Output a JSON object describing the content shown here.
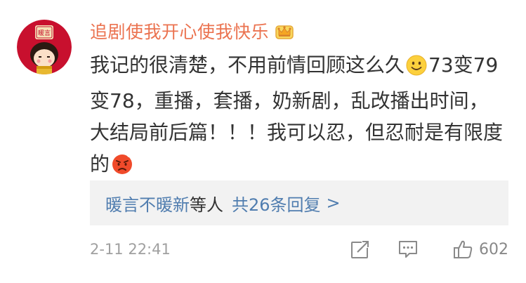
{
  "comment": {
    "username": "追剧使我开心使我快乐",
    "avatar_text": "暖言",
    "body": {
      "part1": "我记的很清楚，不用前情回顾这么久",
      "part2": "73变79变78，重播，套播，奶新剧，乱改播出时间，大结局前后篇！！！我可以忍，但忍耐是有限度的"
    },
    "emoji_1": "smile-emoji",
    "emoji_2": "angry-emoji",
    "badge_icon": "crown-icon",
    "replies": {
      "link_name": "暖言不暖新",
      "suffix": "等人",
      "count_text": "共26条回复",
      "chevron": ">"
    },
    "timestamp": "2-11 22:41",
    "likes": "602",
    "action_icons": [
      "share-icon",
      "comment-icon",
      "like-icon"
    ]
  },
  "colors": {
    "username": "#eb7350",
    "link": "#507daf",
    "text": "#333333",
    "meta": "#a0a0a0",
    "reply_bg": "#f2f2f2"
  }
}
